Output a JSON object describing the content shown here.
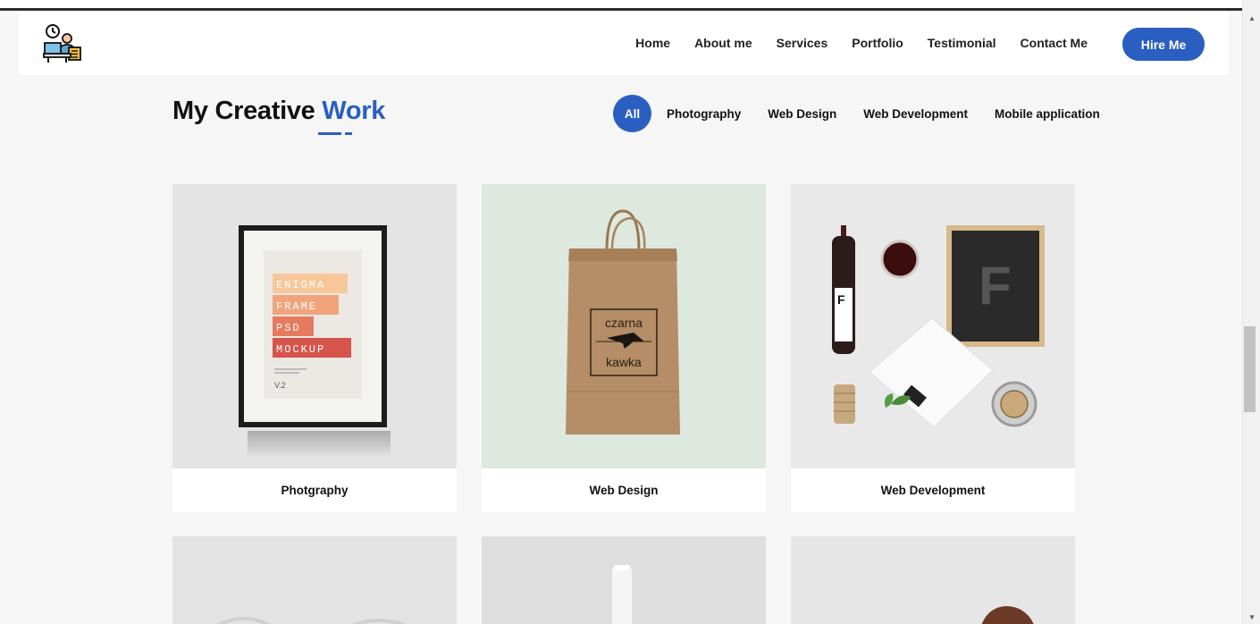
{
  "nav": {
    "items": [
      {
        "label": "Home"
      },
      {
        "label": "About me"
      },
      {
        "label": "Services"
      },
      {
        "label": "Portfolio"
      },
      {
        "label": "Testimonial"
      },
      {
        "label": "Contact Me"
      }
    ],
    "hire_label": "Hire Me"
  },
  "section": {
    "title_main": "My Creative ",
    "title_accent": "Work"
  },
  "filters": {
    "items": [
      {
        "label": "All",
        "active": true
      },
      {
        "label": "Photography"
      },
      {
        "label": "Web Design"
      },
      {
        "label": "Web Development"
      },
      {
        "label": "Mobile application"
      }
    ]
  },
  "portfolio": {
    "items": [
      {
        "caption": "Photgraphy",
        "poster_lines": [
          "ENIGMA",
          "FRAME",
          "PSD",
          "MOCKUP"
        ],
        "poster_version": "V.2"
      },
      {
        "caption": "Web Design",
        "bag_text_top": "czarna",
        "bag_text_bottom": "kawka"
      },
      {
        "caption": "Web Development",
        "brand_letter": "F"
      }
    ]
  },
  "colors": {
    "accent": "#2a5fc1",
    "page_bg": "#f6f6f6"
  }
}
